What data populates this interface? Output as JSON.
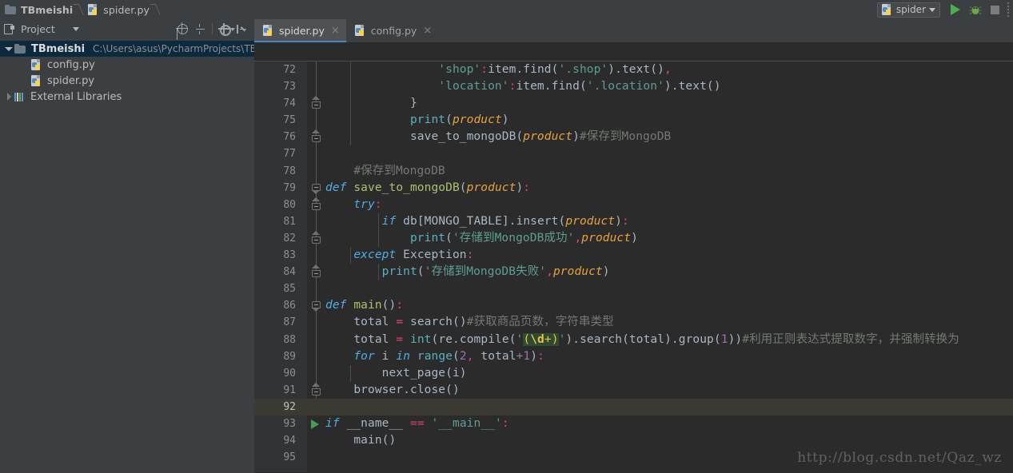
{
  "breadcrumb": {
    "items": [
      {
        "label": "TBmeishi",
        "icon": "folder-icon"
      },
      {
        "label": "spider.py",
        "icon": "python-file-icon"
      }
    ]
  },
  "toolbar_right": {
    "run_config": {
      "label": "spider",
      "icon": "python-file-icon",
      "caret": "chevron-down-icon"
    },
    "run_button": "run-icon",
    "debug_button": "debug-bug-icon",
    "stop_button": "stop-icon"
  },
  "project_panel": {
    "title": "Project",
    "select_icon": "project-select-icon",
    "caret_icon": "chevron-down-icon",
    "tools": [
      "locate-icon",
      "collapse-all-icon",
      "settings-gear-icon",
      "hide-panel-icon"
    ],
    "tree": [
      {
        "name": "TBmeishi",
        "path": "C:\\Users\\asus\\PycharmProjects\\TBme",
        "icon": "folder-icon",
        "selected": true,
        "expanded": true,
        "indent": 0
      },
      {
        "name": "config.py",
        "path": "",
        "icon": "python-file-icon",
        "selected": false,
        "indent": 1
      },
      {
        "name": "spider.py",
        "path": "",
        "icon": "python-file-icon",
        "selected": false,
        "indent": 1
      },
      {
        "name": "External Libraries",
        "path": "",
        "icon": "libraries-icon",
        "selected": false,
        "expanded": false,
        "indent": 0
      }
    ]
  },
  "editor": {
    "tabs": [
      {
        "label": "spider.py",
        "active": true,
        "close": "×",
        "icon": "python-file-icon"
      },
      {
        "label": "config.py",
        "active": false,
        "close": "×",
        "icon": "python-file-icon"
      }
    ],
    "watermark": "http://blog.csdn.net/Qaz_wz",
    "caret_line": 92,
    "lines": [
      {
        "n": 72,
        "text": "                'shop':item.find('.shop').text(),"
      },
      {
        "n": 73,
        "text": "                'location':item.find('.location').text()"
      },
      {
        "n": 74,
        "text": "            }"
      },
      {
        "n": 75,
        "text": "            print(product)"
      },
      {
        "n": 76,
        "text": "            save_to_mongoDB(product)#保存到MongoDB"
      },
      {
        "n": 77,
        "text": ""
      },
      {
        "n": 78,
        "text": "    #保存到MongoDB"
      },
      {
        "n": 79,
        "text": "def save_to_mongoDB(product):"
      },
      {
        "n": 80,
        "text": "    try:"
      },
      {
        "n": 81,
        "text": "        if db[MONGO_TABLE].insert(product):"
      },
      {
        "n": 82,
        "text": "            print('存储到MongoDB成功',product)"
      },
      {
        "n": 83,
        "text": "    except Exception:"
      },
      {
        "n": 84,
        "text": "        print('存储到MongoDB失败',product)"
      },
      {
        "n": 85,
        "text": ""
      },
      {
        "n": 86,
        "text": "def main():"
      },
      {
        "n": 87,
        "text": "    total = search()#获取商品页数，字符串类型"
      },
      {
        "n": 88,
        "text": "    total = int(re.compile('(\\d+)').search(total).group(1))#利用正则表达式提取数字，并强制转换为"
      },
      {
        "n": 89,
        "text": "    for i in range(2, total+1):"
      },
      {
        "n": 90,
        "text": "        next_page(i)"
      },
      {
        "n": 91,
        "text": "    browser.close()"
      },
      {
        "n": 92,
        "text": ""
      },
      {
        "n": 93,
        "text": "if __name__ == '__main__':"
      },
      {
        "n": 94,
        "text": "    main()"
      },
      {
        "n": 95,
        "text": ""
      }
    ]
  },
  "colors": {
    "background": "#2b2b2b",
    "chrome": "#3c3f41",
    "gutter": "#313335",
    "selection": "#0d293e",
    "caret_row": "#3a3a33",
    "accent": "#4a88c7",
    "run_green": "#499c54",
    "string": "#5c9e94",
    "keyword": "#4eade5",
    "function": "#a9c26c",
    "param": "#e8a33d",
    "comment": "#737a72",
    "operator": "#e0427a",
    "number": "#9876aa"
  }
}
